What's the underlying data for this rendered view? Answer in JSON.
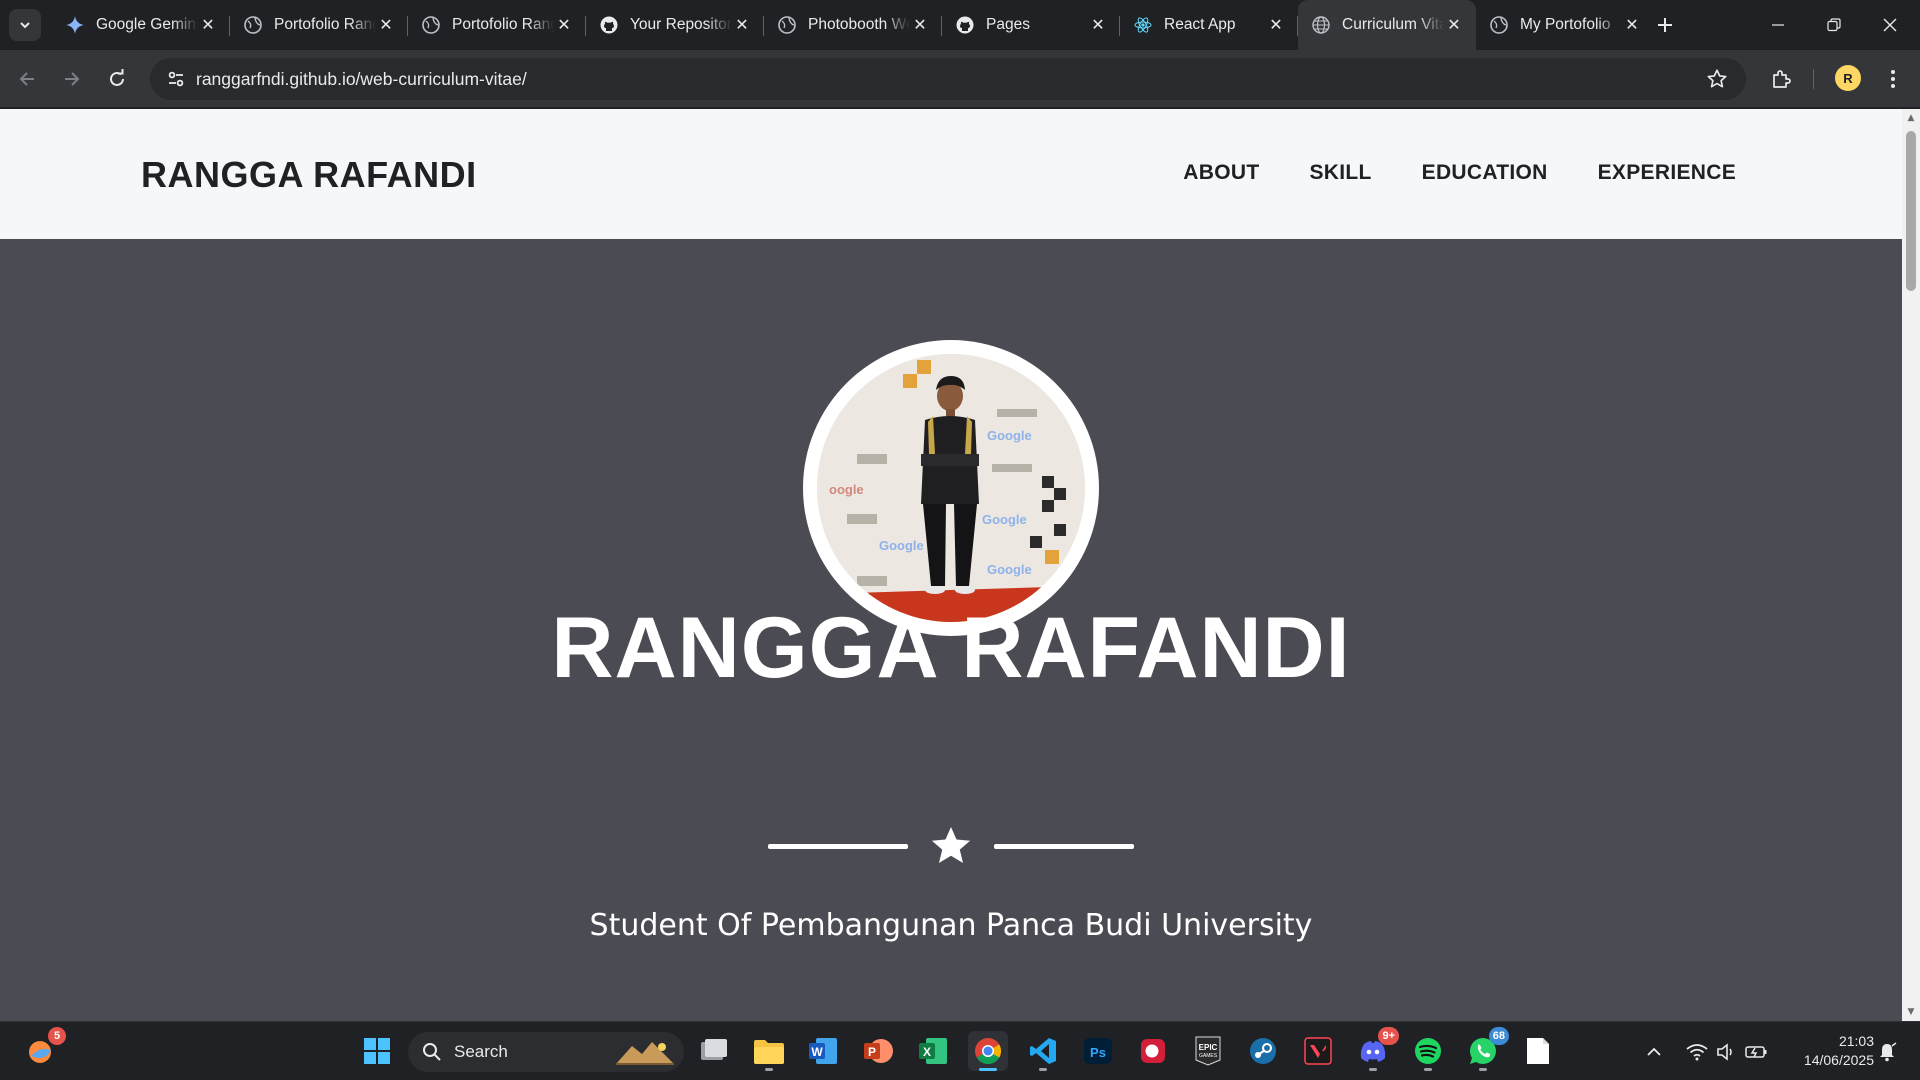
{
  "browser": {
    "tabs": [
      {
        "title": "Google Gemini",
        "icon": "gemini-icon",
        "active": false
      },
      {
        "title": "Portofolio Rangga",
        "icon": "globe-icon",
        "active": false
      },
      {
        "title": "Portofolio Rangga",
        "icon": "globe-icon",
        "active": false
      },
      {
        "title": "Your Repositories",
        "icon": "github-icon",
        "active": false
      },
      {
        "title": "Photobooth Web",
        "icon": "globe-icon",
        "active": false
      },
      {
        "title": "Pages",
        "icon": "github-icon",
        "active": false
      },
      {
        "title": "React App",
        "icon": "react-icon",
        "active": false
      },
      {
        "title": "Curriculum Vitae",
        "icon": "globe-icon",
        "active": true
      },
      {
        "title": "My Portofolio",
        "icon": "globe-icon",
        "active": false
      }
    ],
    "url": "ranggarfndi.github.io/web-curriculum-vitae/",
    "profile_initial": "R"
  },
  "site": {
    "brand": "RANGGA RAFANDI",
    "nav": [
      "ABOUT",
      "SKILL",
      "EDUCATION",
      "EXPERIENCE"
    ],
    "hero_name": "RANGGA RAFANDI",
    "tagline": "Student Of Pembangunan Panca Budi University",
    "colors": {
      "navbar": "#f5f7f8",
      "hero": "#4b4b53",
      "text_dark": "#202124",
      "text_light": "#ffffff"
    }
  },
  "taskbar": {
    "search_placeholder": "Search",
    "widget_badge": "5",
    "discord_badge": "9+",
    "whatsapp_badge": "68",
    "time": "21:03",
    "date": "14/06/2025",
    "apps": [
      "start-icon",
      "task-view-icon",
      "file-explorer-icon",
      "word-icon",
      "powerpoint-icon",
      "excel-icon",
      "chrome-icon",
      "vscode-icon",
      "photoshop-icon",
      "record-app-icon",
      "epic-games-icon",
      "steam-icon",
      "valorant-icon",
      "discord-icon",
      "spotify-icon",
      "whatsapp-icon",
      "notepad-icon"
    ]
  }
}
